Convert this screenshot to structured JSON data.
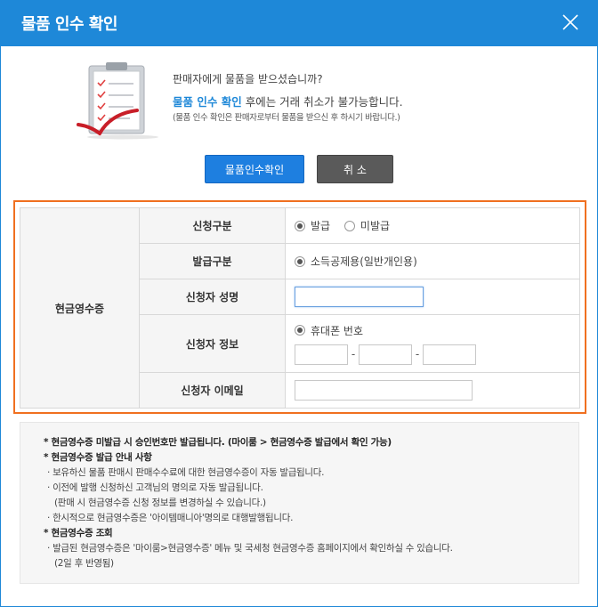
{
  "dialog": {
    "title": "물품 인수 확인"
  },
  "message": {
    "line1": "판매자에게 물품을 받으셨습니까?",
    "line2_highlight": "물품 인수 확인",
    "line2_rest": " 후에는 거래 취소가 불가능합니다.",
    "line3": "(물품 인수 확인은 판매자로부터 물품을 받으신 후 하시기 바랍니다.)"
  },
  "buttons": {
    "confirm": "물품인수확인",
    "cancel": "취 소"
  },
  "receipt": {
    "group_label": "현금영수증",
    "rows": {
      "apply_type": {
        "label": "신청구분",
        "options": [
          "발급",
          "미발급"
        ],
        "selected": "발급"
      },
      "issue_type": {
        "label": "발급구분",
        "option": "소득공제용(일반개인용)"
      },
      "name": {
        "label": "신청자 성명",
        "value": ""
      },
      "info": {
        "label": "신청자 정보",
        "option": "휴대폰 번호",
        "dash": "-"
      },
      "email": {
        "label": "신청자 이메일",
        "value": ""
      }
    }
  },
  "notice": {
    "l1": "* 현금영수증 미발급 시 승인번호만 발급됩니다. (마이룸 > 현금영수증 발급에서 확인 가능)",
    "l2": "* 현금영수증 발급 안내 사항",
    "l3": "· 보유하신 물품 판매시 판매수수료에 대한 현금영수증이 자동 발급됩니다.",
    "l4": "· 이전에 발행 신청하신 고객님의 명의로 자동 발급됩니다.",
    "l5": "(판매 시 현금영수증 신청 정보를 변경하실 수 있습니다.)",
    "l6": "· 한시적으로 현금영수증은 '아이템매니아'명의로 대행발행됩니다.",
    "l7": "* 현금영수증 조회",
    "l8": "· 발급된 현금영수증은 '마이룸>현금영수증' 메뉴 및 국세청 현금영수증 홈페이지에서 확인하실 수 있습니다.",
    "l9": "(2일 후 반영됨)"
  },
  "colors": {
    "header": "#1e88d8",
    "highlight_border": "#f07020",
    "confirm_button": "#1e7fe0",
    "cancel_button": "#5a5a5a"
  },
  "icons": {
    "close": "close-x-icon",
    "illustration": "clipboard-checklist-icon"
  }
}
